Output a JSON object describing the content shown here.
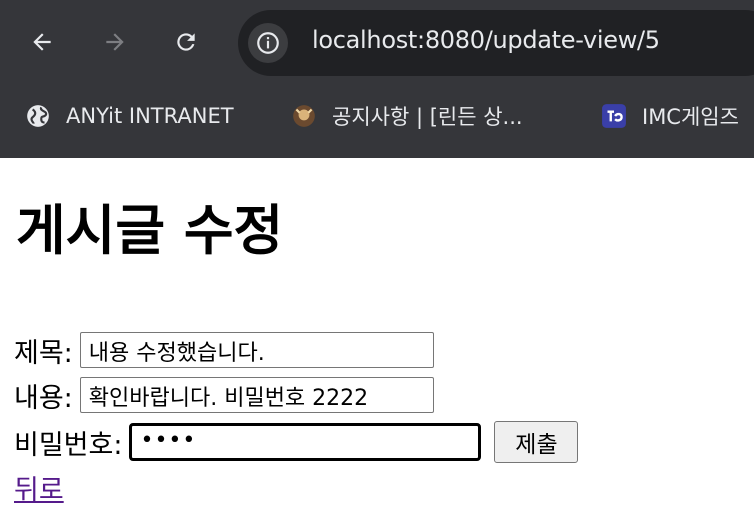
{
  "browser": {
    "url": "localhost:8080/update-view/5",
    "bookmarks": [
      {
        "label": "ANYit INTRANET",
        "icon": "globe-icon"
      },
      {
        "label": "공지사항 | [린든 상...",
        "icon": "site-favicon-icon"
      },
      {
        "label": "IMC게임즈",
        "icon": "imc-favicon-icon"
      }
    ],
    "colors": {
      "chrome_bg": "#35363a",
      "omnibox_bg": "#202124",
      "text": "#e8eaed"
    }
  },
  "page": {
    "title": "게시글 수정",
    "form": {
      "title_label": "제목:",
      "title_value": "내용 수정했습니다.",
      "content_label": "내용:",
      "content_value": "확인바랍니다. 비밀번호 2222",
      "password_label": "비밀번호:",
      "password_value": "••••",
      "submit_label": "제출"
    },
    "back_link": "뒤로",
    "colors": {
      "link": "#551a8b"
    }
  }
}
